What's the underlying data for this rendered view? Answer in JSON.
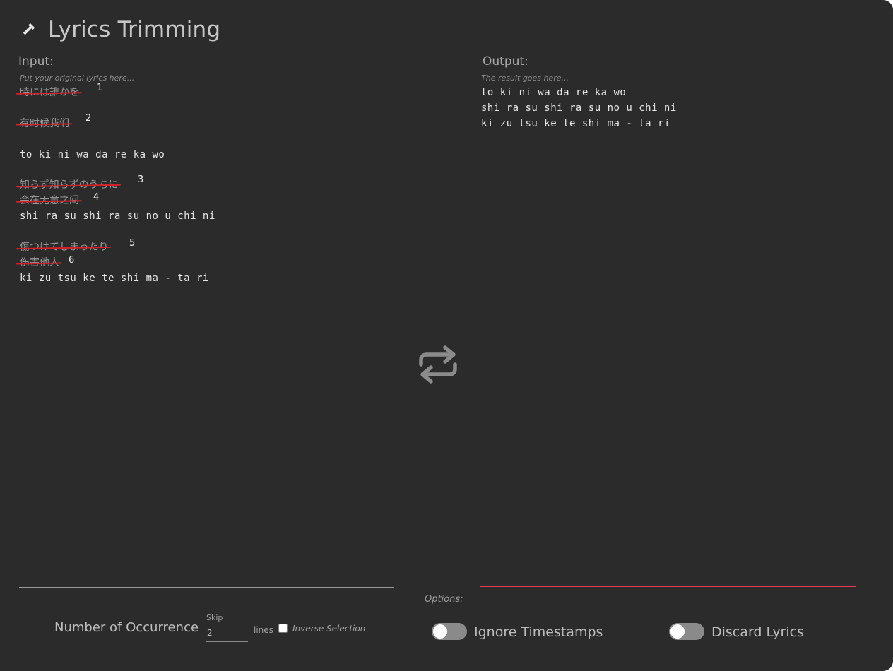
{
  "app": {
    "title": "Lyrics Trimming",
    "icon": "hammer-icon"
  },
  "input": {
    "label": "Input:",
    "placeholder": "Put your original lyrics here...",
    "lines": [
      {
        "text": "時には誰かを",
        "struck": true,
        "badge": "1"
      },
      {
        "text": "有时候我们",
        "struck": true,
        "badge": "2"
      },
      {
        "text": "to ki ni wa da re ka wo",
        "struck": false,
        "badge": ""
      },
      {
        "text": "知らず知らずのうちに",
        "struck": true,
        "badge": "3"
      },
      {
        "text": "会在无意之间",
        "struck": true,
        "badge": "4"
      },
      {
        "text": "shi ra su shi ra su no u chi ni",
        "struck": false,
        "badge": ""
      },
      {
        "text": "傷つけてしまったり",
        "struck": true,
        "badge": "5"
      },
      {
        "text": "伤害他人",
        "struck": true,
        "badge": "6"
      },
      {
        "text": "ki zu tsu ke te shi ma - ta ri",
        "struck": false,
        "badge": ""
      }
    ]
  },
  "output": {
    "label": "Output:",
    "placeholder": "The result goes here...",
    "lines": [
      "to ki ni wa da re ka wo",
      "shi ra su shi ra su no u chi ni",
      "ki zu tsu ke te shi ma - ta ri"
    ]
  },
  "swap": {
    "icon": "swap-arrows-icon"
  },
  "controls": {
    "occurrence_label": "Number of Occurrence",
    "skip_label": "Skip",
    "skip_value": "2",
    "lines_label": "lines",
    "inverse_label": "Inverse Selection",
    "inverse_checked": false
  },
  "options": {
    "label": "Options:",
    "ignore_timestamps": {
      "label": "Ignore Timestamps",
      "on": false
    },
    "discard_lyrics": {
      "label": "Discard Lyrics",
      "on": false
    }
  },
  "colors": {
    "background": "#2b2b2b",
    "strike": "#d81f2a",
    "accent_underline": "#e8365a",
    "toggle_off": "#8a8a8a"
  }
}
